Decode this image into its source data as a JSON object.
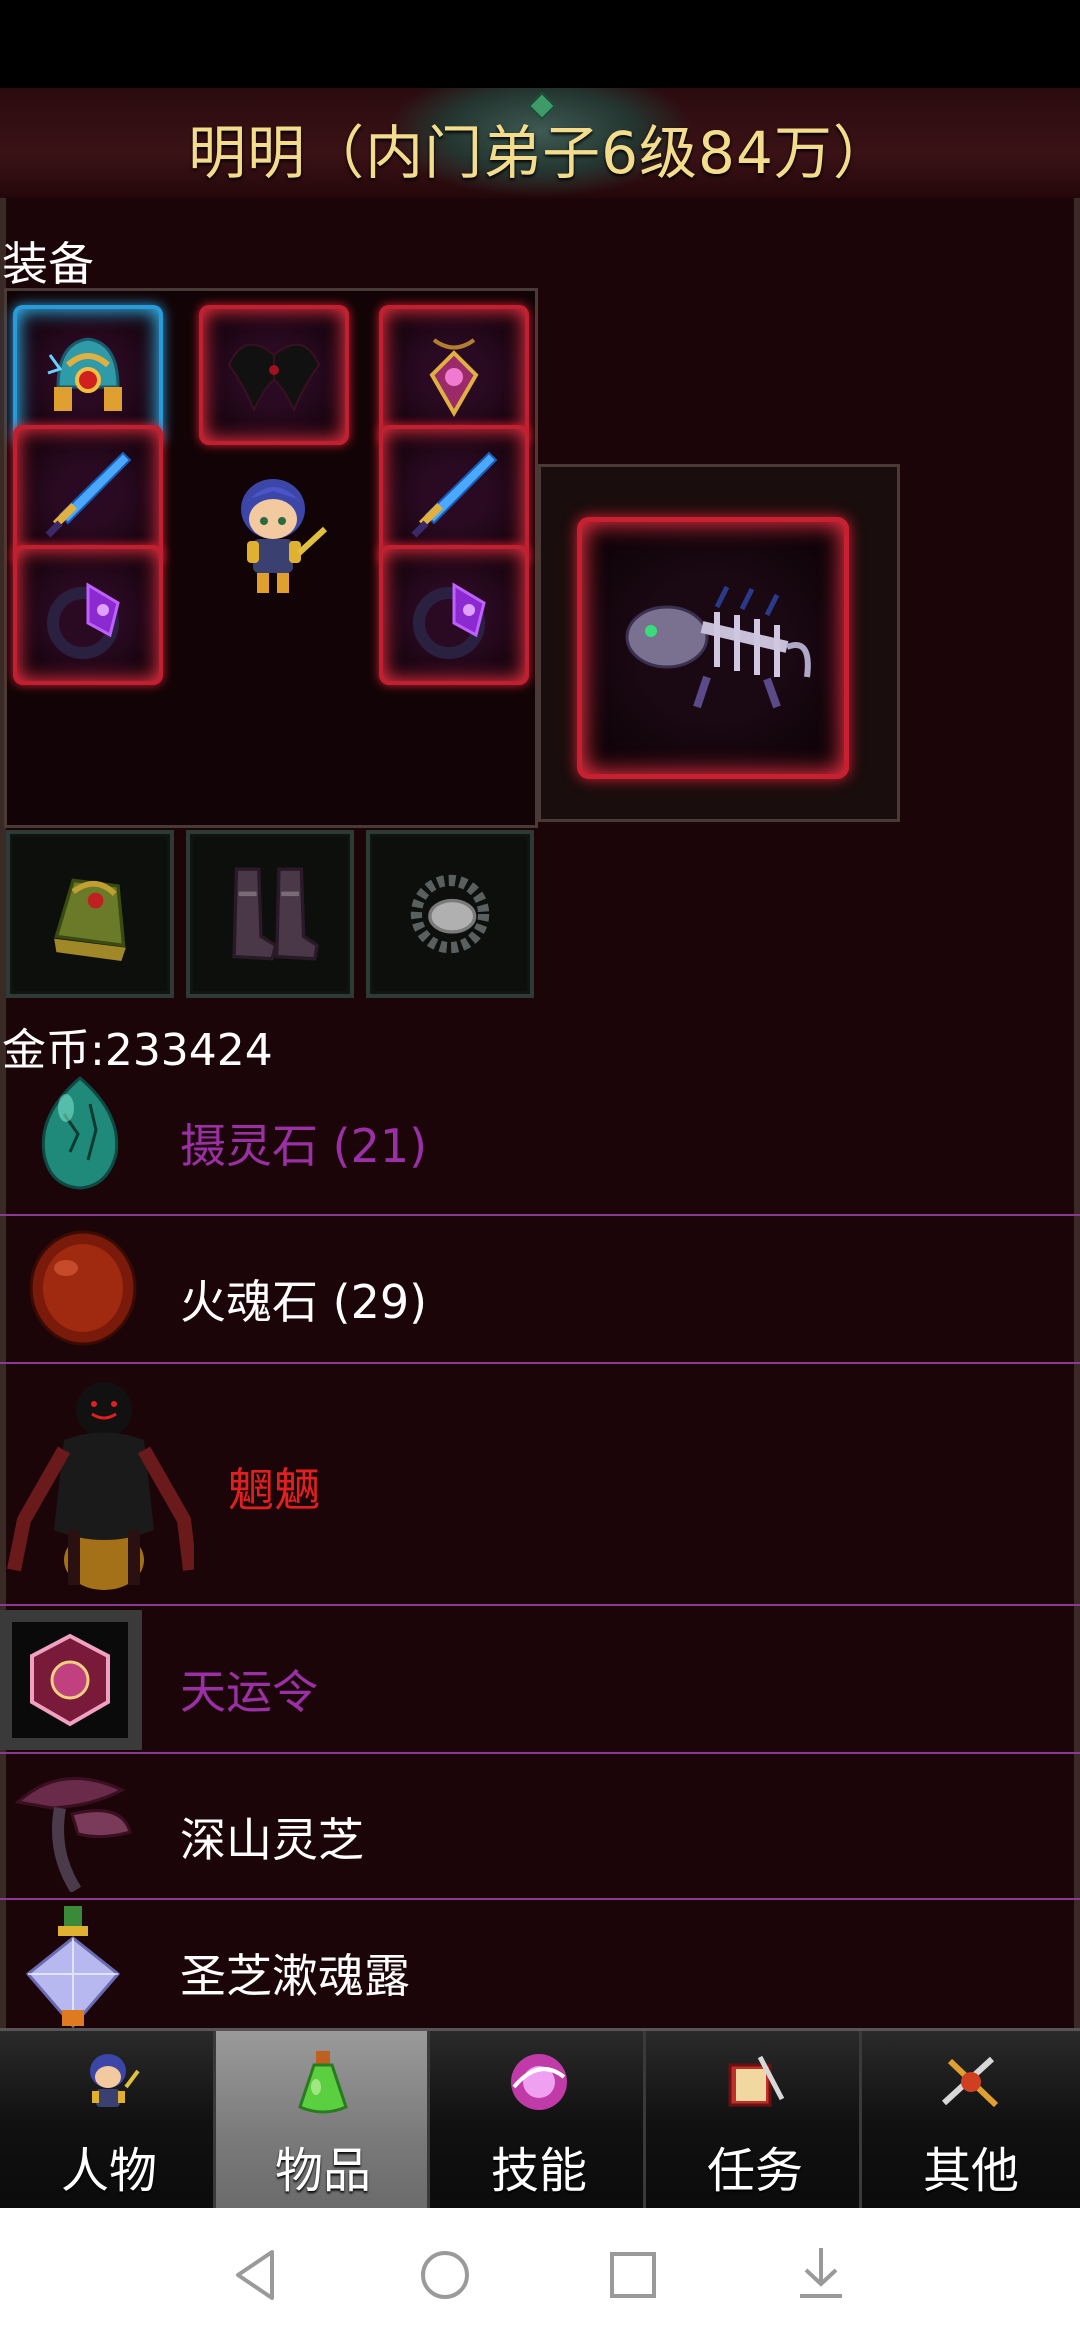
{
  "title": "明明（内门弟子6级84万）",
  "equipment": {
    "label": "装备",
    "slots": [
      {
        "icon": "helmet-icon",
        "rarity": "blue"
      },
      {
        "icon": "wings-icon",
        "rarity": "red"
      },
      {
        "icon": "amulet-icon",
        "rarity": "red"
      },
      {
        "icon": "sword-icon",
        "rarity": "red"
      },
      {
        "icon": "sword-icon",
        "rarity": "red"
      },
      {
        "icon": "ring-icon",
        "rarity": "red"
      },
      {
        "icon": "ring-icon",
        "rarity": "red"
      }
    ],
    "bottom_slots": [
      {
        "icon": "bracer-icon"
      },
      {
        "icon": "boots-icon"
      },
      {
        "icon": "bead-bracelet-icon"
      }
    ],
    "pet": {
      "icon": "skeleton-beast-icon"
    }
  },
  "gold": "金币:233424",
  "items": [
    {
      "name": "摄灵石 (21)",
      "color": "#9a2fa6",
      "icon": "green-egg-icon"
    },
    {
      "name": "火魂石 (29)",
      "color": "#ffffff",
      "icon": "red-stone-icon"
    },
    {
      "name": "魍魉",
      "color": "#e02020",
      "icon": "demon-icon"
    },
    {
      "name": "天运令",
      "color": "#9a2fa6",
      "icon": "token-icon"
    },
    {
      "name": "深山灵芝",
      "color": "#ffffff",
      "icon": "mushroom-icon"
    },
    {
      "name": "圣芝漱魂露",
      "color": "#ffffff",
      "icon": "crystal-bottle-icon"
    }
  ],
  "tabs": [
    {
      "label": "人物",
      "icon": "character-icon",
      "active": false
    },
    {
      "label": "物品",
      "icon": "potion-icon",
      "active": true
    },
    {
      "label": "技能",
      "icon": "skill-orb-icon",
      "active": false
    },
    {
      "label": "任务",
      "icon": "quest-book-icon",
      "active": false
    },
    {
      "label": "其他",
      "icon": "crossed-swords-icon",
      "active": false
    }
  ],
  "system_nav": [
    "back-icon",
    "home-icon",
    "recents-icon",
    "notification-icon"
  ]
}
